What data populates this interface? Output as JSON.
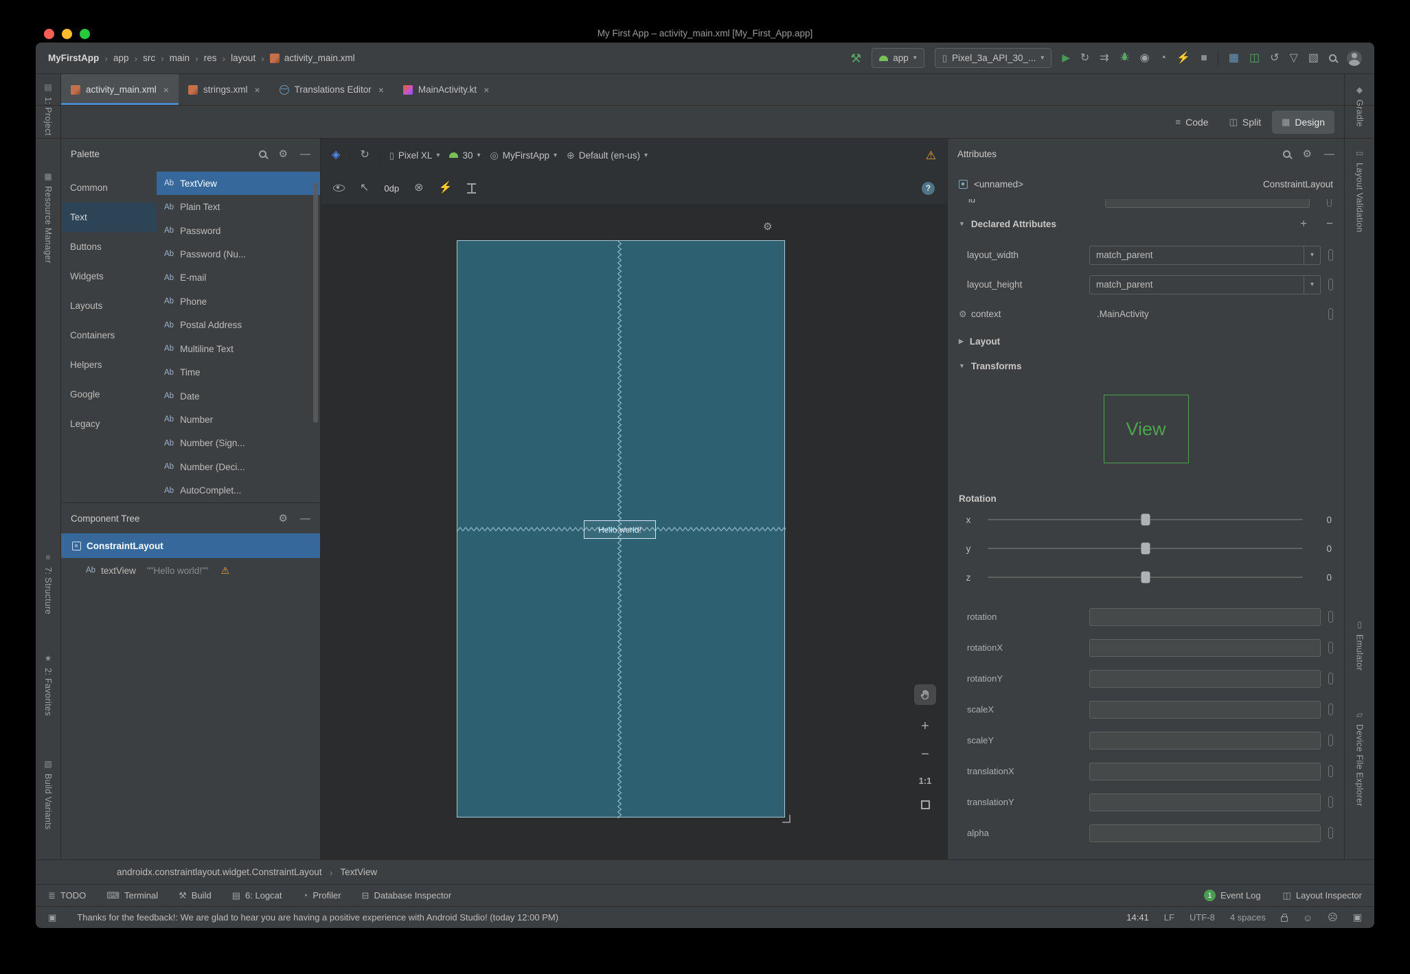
{
  "titlebar": {
    "title": "My First App – activity_main.xml [My_First_App.app]"
  },
  "toolbar": {
    "crumbs": [
      "MyFirstApp",
      "app",
      "src",
      "main",
      "res",
      "layout",
      "activity_main.xml"
    ],
    "run_chip": "app",
    "device_chip": "Pixel_3a_API_30_..."
  },
  "tabs": [
    "activity_main.xml",
    "strings.xml",
    "Translations Editor",
    "MainActivity.kt"
  ],
  "viewmodes": [
    "Code",
    "Split",
    "Design"
  ],
  "strips": {
    "left": [
      "1: Project",
      "Resource Manager",
      "7: Structure",
      "2: Favorites",
      "Build Variants"
    ],
    "right": [
      "Gradle",
      "Layout Validation",
      "Emulator",
      "Device File Explorer"
    ]
  },
  "palette": {
    "title": "Palette",
    "categories": [
      "Common",
      "Text",
      "Buttons",
      "Widgets",
      "Layouts",
      "Containers",
      "Helpers",
      "Google",
      "Legacy"
    ],
    "items": [
      "TextView",
      "Plain Text",
      "Password",
      "Password (Nu...",
      "E-mail",
      "Phone",
      "Postal Address",
      "Multiline Text",
      "Time",
      "Date",
      "Number",
      "Number (Sign...",
      "Number (Deci...",
      "AutoComplet..."
    ]
  },
  "tree": {
    "title": "Component Tree",
    "root": "ConstraintLayout",
    "child": "textView",
    "child_detail": "\"\"Hello world!\"\""
  },
  "design": {
    "device": "Pixel XL",
    "api": "30",
    "theme": "MyFirstApp",
    "locale": "Default (en-us)",
    "margin": "0dp"
  },
  "canvas": {
    "hello": "Hello world!",
    "zoom_label": "1:1"
  },
  "attrs": {
    "title": "Attributes",
    "name": "<unnamed>",
    "type": "ConstraintLayout",
    "partial_label": "id",
    "declared": {
      "title": "Declared Attributes",
      "rows": [
        {
          "name": "layout_width",
          "value": "match_parent"
        },
        {
          "name": "layout_height",
          "value": "match_parent"
        },
        {
          "name": "context",
          "value": ".MainActivity"
        }
      ]
    },
    "section_layout": "Layout",
    "section_transforms": "Transforms",
    "view_label": "View",
    "rotation_title": "Rotation",
    "sliders": [
      {
        "axis": "x",
        "value": "0"
      },
      {
        "axis": "y",
        "value": "0"
      },
      {
        "axis": "z",
        "value": "0"
      }
    ],
    "fields": [
      "rotation",
      "rotationX",
      "rotationY",
      "scaleX",
      "scaleY",
      "translationX",
      "translationY",
      "alpha"
    ]
  },
  "footer": {
    "crumbs": [
      "androidx.constraintlayout.widget.ConstraintLayout",
      "TextView"
    ],
    "tools": [
      "TODO",
      "Terminal",
      "Build",
      "6: Logcat",
      "Profiler",
      "Database Inspector"
    ],
    "event_badge": "1",
    "event_log": "Event Log",
    "layout_inspector": "Layout Inspector"
  },
  "status": {
    "message": "Thanks for the feedback!: We are glad to hear you are having a positive experience with Android Studio! (today 12:00 PM)",
    "time": "14:41",
    "line_sep": "LF",
    "encoding": "UTF-8",
    "indent": "4 spaces"
  },
  "colors": {
    "accent_blue": "#4A88C7",
    "selection_blue": "#36689C",
    "canvas_teal": "#2D6171",
    "warning_orange": "#F0A732",
    "run_green": "#499C54",
    "view_green": "#4DA34D"
  },
  "icons": {
    "ab": "Ab",
    "gear": "⚙",
    "minimize": "—",
    "close": "×",
    "caret": "▾",
    "chevron": "›",
    "expanded": "▼",
    "collapsed": "▶",
    "warning": "⚠",
    "hammer": "⚒",
    "play": "▶",
    "refresh": "↻",
    "double_arrow": "⇉",
    "target": "◉",
    "gauge": "◔",
    "bolt": "⚡",
    "stop": "■",
    "grid": "▦",
    "monitor": "◫",
    "undo": "↺",
    "down": "▽",
    "diag": "▧",
    "layers": "◈",
    "phone": "▯",
    "theme": "◎",
    "globe": "⊕",
    "pointer": "↖",
    "clear": "⊗",
    "question": "?",
    "plus": "+",
    "minus": "−",
    "star": "★",
    "smile": "☺",
    "frown": "☹",
    "list": "≣",
    "keyboard": "⌨",
    "db": "⊟",
    "rows": "▤",
    "code": "≡",
    "split": "◫",
    "diamond": "◆",
    "hrect": "▭",
    "para": "▱",
    "win": "▣"
  }
}
